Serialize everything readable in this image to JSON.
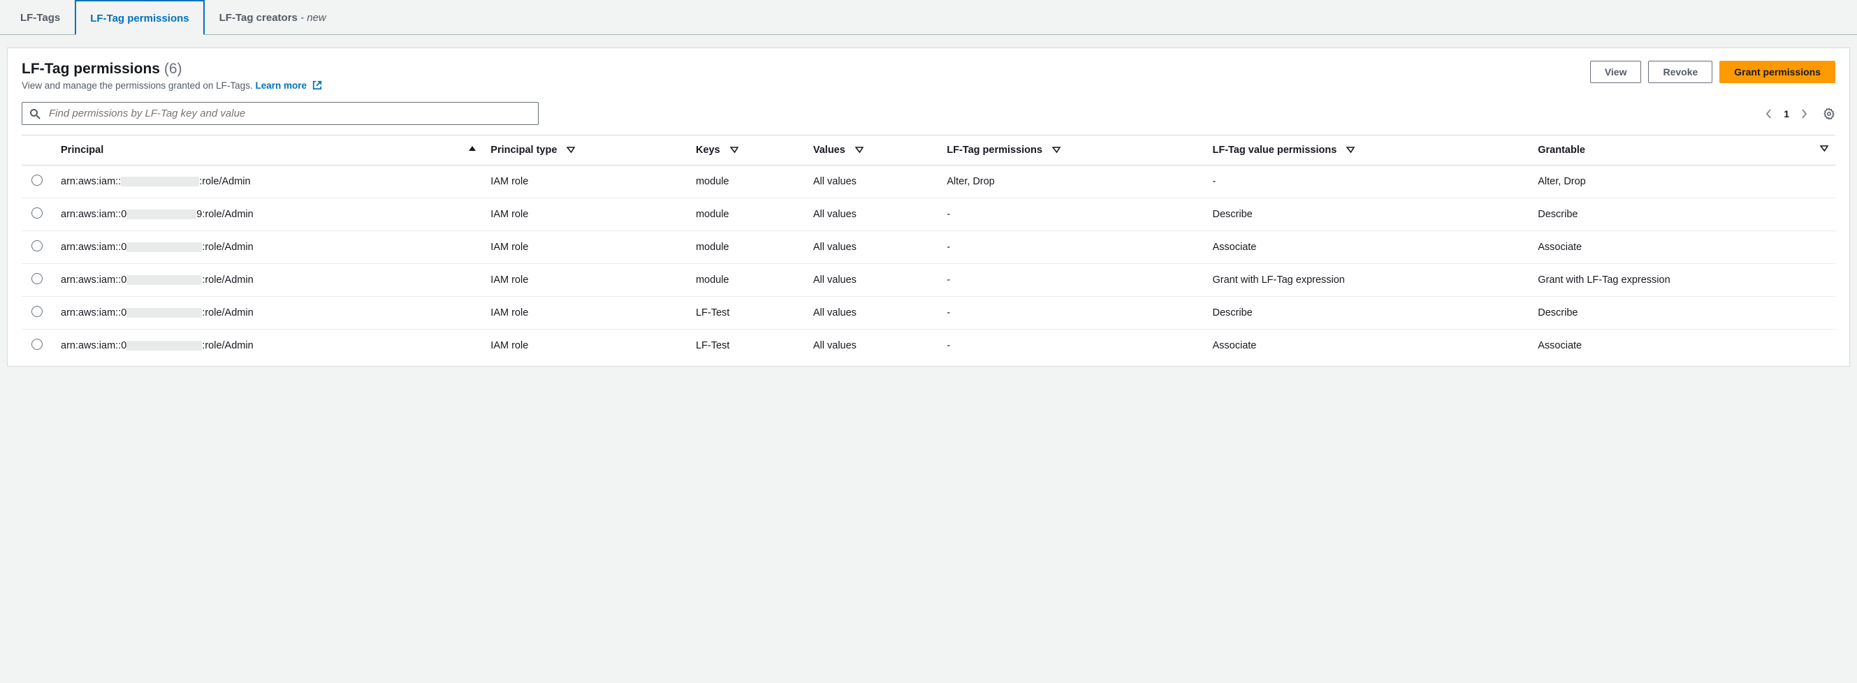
{
  "tabs": [
    {
      "label": "LF-Tags",
      "active": false,
      "new": false
    },
    {
      "label": "LF-Tag permissions",
      "active": true,
      "new": false
    },
    {
      "label": "LF-Tag creators",
      "active": false,
      "new": true,
      "new_label": " - new"
    }
  ],
  "header": {
    "title": "LF-Tag permissions",
    "count": "(6)",
    "description": "View and manage the permissions granted on LF-Tags.",
    "learn_more": "Learn more"
  },
  "buttons": {
    "view": "View",
    "revoke": "Revoke",
    "grant": "Grant permissions"
  },
  "search": {
    "placeholder": "Find permissions by LF-Tag key and value"
  },
  "pager": {
    "page": "1"
  },
  "columns": {
    "principal": "Principal",
    "principal_type": "Principal type",
    "keys": "Keys",
    "values": "Values",
    "lf_tag_permissions": "LF-Tag permissions",
    "lf_tag_value_permissions": "LF-Tag value permissions",
    "grantable": "Grantable"
  },
  "rows": [
    {
      "principal_prefix": "arn:aws:iam::",
      "redact_width": 112,
      "principal_suffix": ":role/Admin",
      "principal_type": "IAM role",
      "keys": "module",
      "values": "All values",
      "lf_tag_permissions": "Alter, Drop",
      "lf_tag_value_permissions": "-",
      "grantable": "Alter, Drop"
    },
    {
      "principal_prefix": "arn:aws:iam::0",
      "redact_width": 100,
      "principal_suffix": "9:role/Admin",
      "principal_type": "IAM role",
      "keys": "module",
      "values": "All values",
      "lf_tag_permissions": "-",
      "lf_tag_value_permissions": "Describe",
      "grantable": "Describe"
    },
    {
      "principal_prefix": "arn:aws:iam::0",
      "redact_width": 108,
      "principal_suffix": ":role/Admin",
      "principal_type": "IAM role",
      "keys": "module",
      "values": "All values",
      "lf_tag_permissions": "-",
      "lf_tag_value_permissions": "Associate",
      "grantable": "Associate"
    },
    {
      "principal_prefix": "arn:aws:iam::0",
      "redact_width": 108,
      "principal_suffix": ":role/Admin",
      "principal_type": "IAM role",
      "keys": "module",
      "values": "All values",
      "lf_tag_permissions": "-",
      "lf_tag_value_permissions": "Grant with LF-Tag expression",
      "grantable": "Grant with LF-Tag expression"
    },
    {
      "principal_prefix": "arn:aws:iam::0",
      "redact_width": 108,
      "principal_suffix": ":role/Admin",
      "principal_type": "IAM role",
      "keys": "LF-Test",
      "values": "All values",
      "lf_tag_permissions": "-",
      "lf_tag_value_permissions": "Describe",
      "grantable": "Describe"
    },
    {
      "principal_prefix": "arn:aws:iam::0",
      "redact_width": 108,
      "principal_suffix": ":role/Admin",
      "principal_type": "IAM role",
      "keys": "LF-Test",
      "values": "All values",
      "lf_tag_permissions": "-",
      "lf_tag_value_permissions": "Associate",
      "grantable": "Associate"
    }
  ]
}
